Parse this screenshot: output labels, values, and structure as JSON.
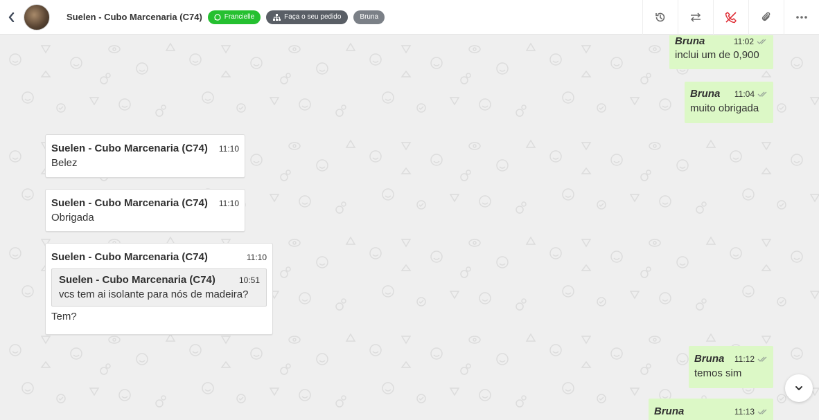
{
  "header": {
    "contact_name": "Suelen - Cubo Marcenaria (C74)",
    "tags": [
      {
        "label": "Francielle",
        "icon": "whatsapp-icon",
        "color": "#25c030"
      },
      {
        "label": "Faça o seu pedido",
        "icon": "sitemap-icon",
        "color": "#5a5f66"
      },
      {
        "label": "Bruna",
        "color": "#7b8087"
      }
    ],
    "actions": [
      "history-icon",
      "transfer-icon",
      "hangup-icon",
      "attach-icon",
      "more-icon"
    ]
  },
  "messages": [
    {
      "direction": "out",
      "sender": "Bruna",
      "time": "11:02",
      "text": "inclui um de 0,900"
    },
    {
      "direction": "out",
      "sender": "Bruna",
      "time": "11:04",
      "text": "muito obrigada"
    },
    {
      "direction": "in",
      "sender": "Suelen - Cubo Marcenaria (C74)",
      "time": "11:10",
      "text": "Belez"
    },
    {
      "direction": "in",
      "sender": "Suelen - Cubo Marcenaria (C74)",
      "time": "11:10",
      "text": "Obrigada"
    },
    {
      "direction": "in",
      "sender": "Suelen - Cubo Marcenaria (C74)",
      "time": "11:10",
      "text": "Tem?",
      "quote": {
        "sender": "Suelen - Cubo Marcenaria (C74)",
        "time": "10:51",
        "text": "vcs tem ai isolante para nós de madeira?"
      }
    },
    {
      "direction": "out",
      "sender": "Bruna",
      "time": "11:12",
      "text": "temos sim"
    },
    {
      "direction": "out",
      "sender": "Bruna",
      "time": "11:13",
      "text": ""
    }
  ],
  "colors": {
    "outgoing_bubble": "#dcf8c6",
    "incoming_bubble": "#ffffff",
    "chat_background": "#efefef",
    "hangup": "#e0323a"
  }
}
